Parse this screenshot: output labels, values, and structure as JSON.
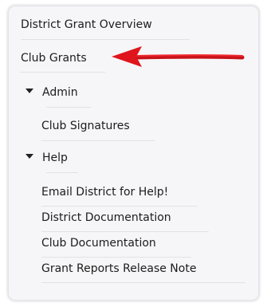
{
  "nav": {
    "district_grant_overview": "District Grant Overview",
    "club_grants": "Club Grants",
    "admin": {
      "label": "Admin",
      "items": [
        "Club Signatures"
      ]
    },
    "help": {
      "label": "Help",
      "items": [
        "Email District for Help!",
        "District Documentation",
        "Club Documentation",
        "Grant Reports Release Note"
      ]
    }
  },
  "colors": {
    "panel_background": "#f6f6f8",
    "text": "#1c1c1c",
    "divider": "#e2e2e6",
    "annotation_arrow": "#e0141c"
  },
  "icons": {
    "section_toggle": "caret-down-icon",
    "annotation": "red-arrow-annotation"
  }
}
